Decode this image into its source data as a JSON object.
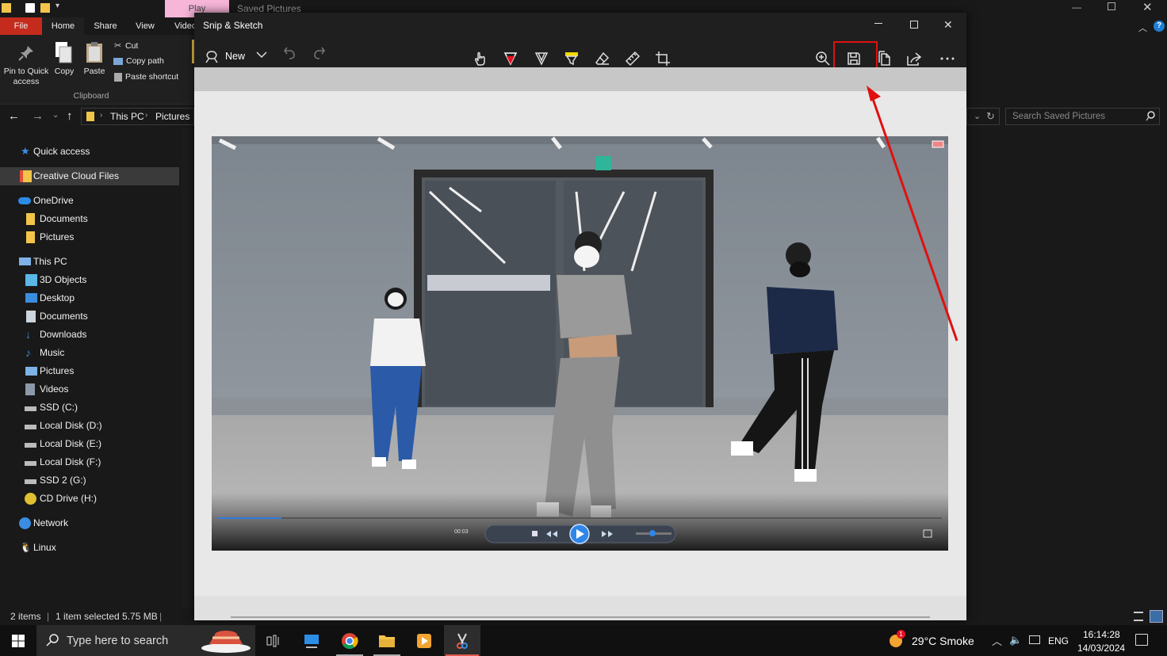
{
  "explorer": {
    "window_title": "Saved Pictures",
    "context_tab": "Play",
    "tabs": {
      "file": "File",
      "home": "Home",
      "share": "Share",
      "view": "View",
      "video": "Video"
    },
    "ribbon": {
      "pin": "Pin to Quick access",
      "copy": "Copy",
      "paste": "Paste",
      "cut": "Cut",
      "copy_path": "Copy path",
      "paste_shortcut": "Paste shortcut",
      "group_clipboard": "Clipboard"
    },
    "address": {
      "this_pc": "This PC",
      "pictures": "Pictures"
    },
    "search_placeholder": "Search Saved Pictures",
    "nav": {
      "quick_access": "Quick access",
      "creative_cloud": "Creative Cloud Files",
      "onedrive": "OneDrive",
      "od_documents": "Documents",
      "od_pictures": "Pictures",
      "this_pc": "This PC",
      "objects3d": "3D Objects",
      "desktop": "Desktop",
      "documents": "Documents",
      "downloads": "Downloads",
      "music": "Music",
      "pictures": "Pictures",
      "videos": "Videos",
      "ssd_c": "SSD (C:)",
      "disk_d": "Local Disk (D:)",
      "disk_e": "Local Disk (E:)",
      "disk_f": "Local Disk (F:)",
      "ssd2_g": "SSD 2 (G:)",
      "cd_h": "CD Drive (H:)",
      "network": "Network",
      "linux": "Linux"
    },
    "status": {
      "items": "2 items",
      "selected": "1 item selected  5.75 MB"
    }
  },
  "snip": {
    "title": "Snip & Sketch",
    "new_label": "New",
    "player_time": "00:03"
  },
  "taskbar": {
    "search_placeholder": "Type here to search",
    "weather": "29°C  Smoke",
    "weather_badge": "1",
    "lang": "ENG",
    "time": "16:14:28",
    "date": "14/03/2024"
  },
  "colors": {
    "accent_red": "#e81123",
    "pen_yellow": "#f5d800",
    "selection": "#3a3a3a",
    "folder": "#f2c54a"
  }
}
